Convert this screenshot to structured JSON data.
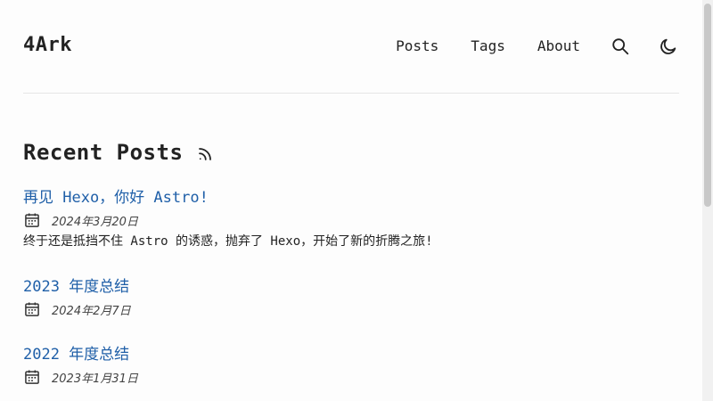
{
  "header": {
    "logo": "4Ark",
    "nav": [
      {
        "label": "Posts"
      },
      {
        "label": "Tags"
      },
      {
        "label": "About"
      }
    ],
    "icons": [
      "search-icon",
      "moon-icon"
    ]
  },
  "main": {
    "section_title": "Recent Posts",
    "section_icon": "rss-icon",
    "posts": [
      {
        "title": "再见 Hexo，你好 Astro!",
        "date": "2024年3月20日",
        "description": "终于还是抵挡不住 Astro 的诱惑，抛弃了 Hexo，开始了新的折腾之旅!"
      },
      {
        "title": "2023 年度总结",
        "date": "2024年2月7日"
      },
      {
        "title": "2022 年度总结",
        "date": "2023年1月31日"
      }
    ]
  },
  "colors": {
    "accent": "#1f5fa8",
    "text": "#222222",
    "background": "#fdfdfd",
    "divider": "#e6e6e6"
  }
}
